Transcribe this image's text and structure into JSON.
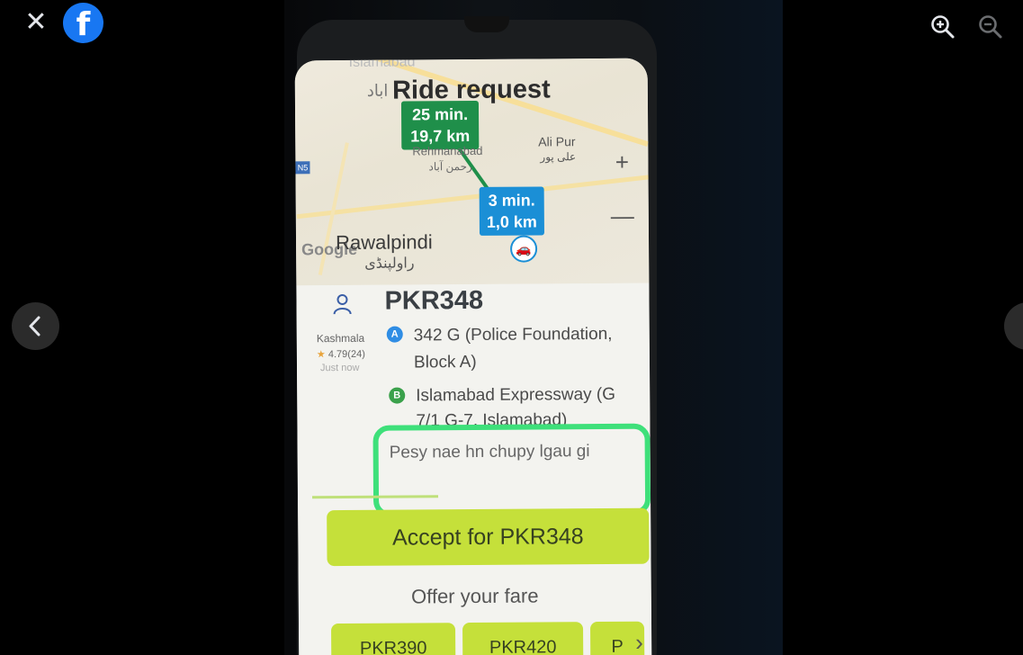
{
  "viewer": {
    "close_label": "✕",
    "brand_letter": "f"
  },
  "map": {
    "title": "Ride request",
    "title_urdu": "اباد",
    "faded_top": "Islamabad",
    "eta_far": {
      "time": "25 min.",
      "distance": "19,7 km"
    },
    "eta_near": {
      "time": "3 min.",
      "distance": "1,0 km"
    },
    "places": {
      "rehmanabad": "Rehmanabad",
      "rehmanabad_urdu": "رحمن آباد",
      "alipur": "Ali Pur",
      "alipur_urdu": "علی پور",
      "rawalpindi": "Rawalpindi",
      "rawalpindi_urdu": "راولپنڈی"
    },
    "google_logo": "Google",
    "side_tag": "N5",
    "zoom_plus": "+",
    "zoom_minus": "—"
  },
  "request": {
    "fare": "PKR348",
    "passenger_name": "Kashmala",
    "rating": "4.79",
    "rating_count": "(24)",
    "time_ago": "Just now",
    "pickup_pin": "A",
    "pickup": "342 G (Police Foundation, Block A)",
    "dropoff_pin": "B",
    "dropoff": "Islamabad Expressway (G 7/1 G-7, Islamabad)",
    "comment": "Pesy nae hn chupy lgau gi",
    "accept_label": "Accept for PKR348",
    "offer_label": "Offer your fare",
    "fare_options": [
      "PKR390",
      "PKR420",
      "P"
    ]
  },
  "colors": {
    "accent_green": "#c5e03a",
    "route_green": "#1f8f4a",
    "route_blue": "#1b8fd6",
    "highlight": "#3ee07a",
    "facebook_blue": "#1877f2"
  }
}
